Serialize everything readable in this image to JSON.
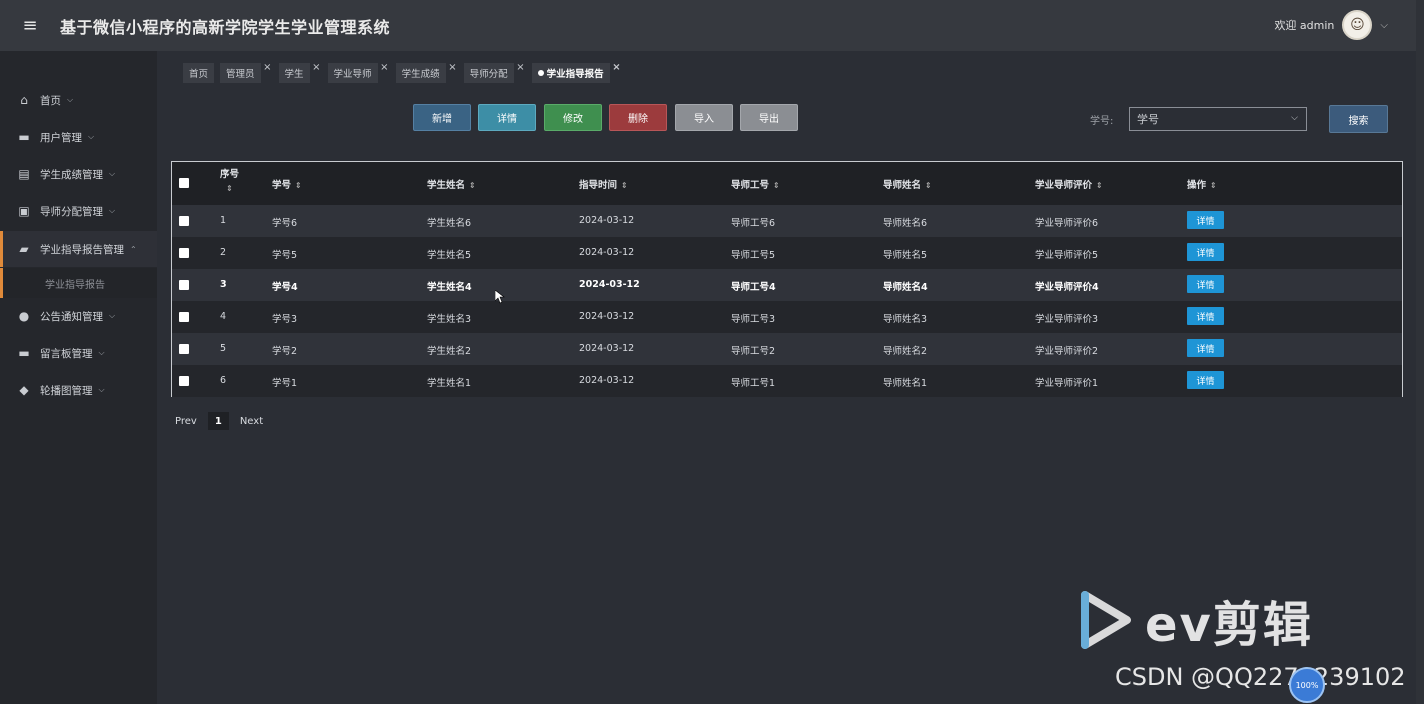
{
  "header": {
    "title": "基于微信小程序的高新学院学生学业管理系统",
    "welcome": "欢迎 admin"
  },
  "sidebar": {
    "items": [
      {
        "label": "首页",
        "icon": "home-icon"
      },
      {
        "label": "用户管理",
        "icon": "user-card-icon"
      },
      {
        "label": "学生成绩管理",
        "icon": "grade-icon"
      },
      {
        "label": "导师分配管理",
        "icon": "assign-icon"
      },
      {
        "label": "学业指导报告管理",
        "icon": "briefcase-icon"
      },
      {
        "label": "公告通知管理",
        "icon": "compass-icon"
      },
      {
        "label": "留言板管理",
        "icon": "board-icon"
      },
      {
        "label": "轮播图管理",
        "icon": "drop-icon"
      }
    ],
    "subitem": "学业指导报告"
  },
  "tabs": [
    "首页",
    "管理员",
    "学生",
    "学业导师",
    "学生成绩",
    "导师分配",
    "学业指导报告"
  ],
  "toolbar": {
    "add": "新增",
    "detail": "详情",
    "edit": "修改",
    "delete": "删除",
    "import": "导入",
    "export": "导出",
    "search_label": "学号:",
    "search_select": "学号",
    "search": "搜索"
  },
  "table": {
    "headers": [
      "序号",
      "学号",
      "学生姓名",
      "指导时间",
      "导师工号",
      "导师姓名",
      "学业导师评价",
      "操作"
    ],
    "rows": [
      [
        "1",
        "学号6",
        "学生姓名6",
        "2024-03-12",
        "导师工号6",
        "导师姓名6",
        "学业导师评价6"
      ],
      [
        "2",
        "学号5",
        "学生姓名5",
        "2024-03-12",
        "导师工号5",
        "导师姓名5",
        "学业导师评价5"
      ],
      [
        "3",
        "学号4",
        "学生姓名4",
        "2024-03-12",
        "导师工号4",
        "导师姓名4",
        "学业导师评价4"
      ],
      [
        "4",
        "学号3",
        "学生姓名3",
        "2024-03-12",
        "导师工号3",
        "导师姓名3",
        "学业导师评价3"
      ],
      [
        "5",
        "学号2",
        "学生姓名2",
        "2024-03-12",
        "导师工号2",
        "导师姓名2",
        "学业导师评价2"
      ],
      [
        "6",
        "学号1",
        "学生姓名1",
        "2024-03-12",
        "导师工号1",
        "导师姓名1",
        "学业导师评价1"
      ]
    ],
    "row_action": "详情"
  },
  "pager": {
    "prev": "Prev",
    "page": "1",
    "next": "Next"
  },
  "overlay": {
    "ev_brand": "ev剪辑",
    "csdn": "CSDN @QQ2279239102",
    "speed": "100%"
  },
  "colors": {
    "add": "#3a6384",
    "detail": "#3d8ea6",
    "edit": "#3f8f4f",
    "delete": "#9c3b3d",
    "import": "#8b8e93",
    "export": "#8b8e93",
    "accent": "#e08a3a",
    "row_action": "#1e95d6"
  }
}
